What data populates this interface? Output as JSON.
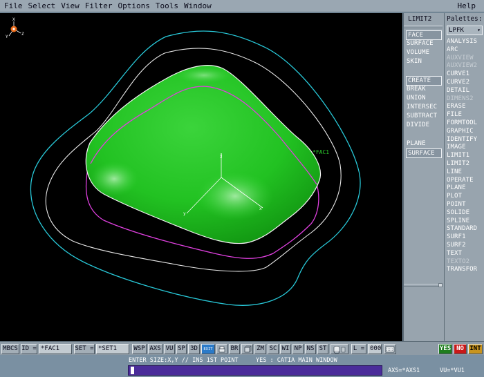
{
  "menu": {
    "items": [
      "File",
      "Select",
      "View",
      "Filter",
      "Options",
      "Tools",
      "Window"
    ],
    "help": "Help"
  },
  "viewport": {
    "axis_labels": {
      "x": "X",
      "y": "Y",
      "z": "Z"
    },
    "face_label": "*FAC1"
  },
  "limit_panel": {
    "title": "LIMIT2",
    "group1": [
      "FACE",
      "SURFACE",
      "VOLUME",
      "SKIN"
    ],
    "group2": [
      "CREATE",
      "BREAK",
      "UNION",
      "INTERSEC",
      "SUBTRACT",
      "DIVIDE"
    ],
    "group3": [
      "PLANE",
      "SURFACE"
    ]
  },
  "palettes": {
    "title": "Palettes:",
    "selected": "LPFK",
    "items": [
      "ANALYSIS",
      "ARC",
      "AUXVIEW",
      "AUXVIEW2",
      "CURVE1",
      "CURVE2",
      "DETAIL",
      "DIMENS2",
      "ERASE",
      "FILE",
      "FORMTOOL",
      "GRAPHIC",
      "IDENTIFY",
      "IMAGE",
      "LIMIT1",
      "LIMIT2",
      "LINE",
      "OPERATE",
      "PLANE",
      "PLOT",
      "POINT",
      "SOLIDE",
      "SPLINE",
      "STANDARD",
      "SURF1",
      "SURF2",
      "TEXT",
      "TEXTO2",
      "TRANSFOR"
    ],
    "dim_items": [
      "AUXVIEW",
      "AUXVIEW2",
      "DIMENS2",
      "TEXTO2"
    ]
  },
  "toolbar": {
    "mbcs": "MBCS",
    "id_label": "ID =",
    "id_value": "*FAC1",
    "set_label": "SET =",
    "set_value": "*SET1",
    "buttons": [
      "WSP",
      "AXS",
      "VU",
      "SP",
      "3D"
    ],
    "exit_label": "EXIT",
    "buttons2": [
      "BR",
      "ZM",
      "SC",
      "WI",
      "NP",
      "NS",
      "ST"
    ],
    "l_label": "L =",
    "l_value": "000",
    "yes": "YES",
    "no": "NO",
    "int": "INT",
    "colors": {
      "yes": "#1e7d1e",
      "no": "#c81818",
      "int": "#c8941e"
    }
  },
  "status": {
    "prompt": "ENTER SIZE:X,Y // INS 1ST POINT",
    "window": "YES : CATIA MAIN WINDOW",
    "axs": "AXS=*AXS1",
    "vu": "VU=*VU1"
  },
  "colors": {
    "surface": "#2ccc2c",
    "inner_contour": "#e040e0",
    "outer_contour": "#28c8d8",
    "viewport_bg": "#000000"
  }
}
